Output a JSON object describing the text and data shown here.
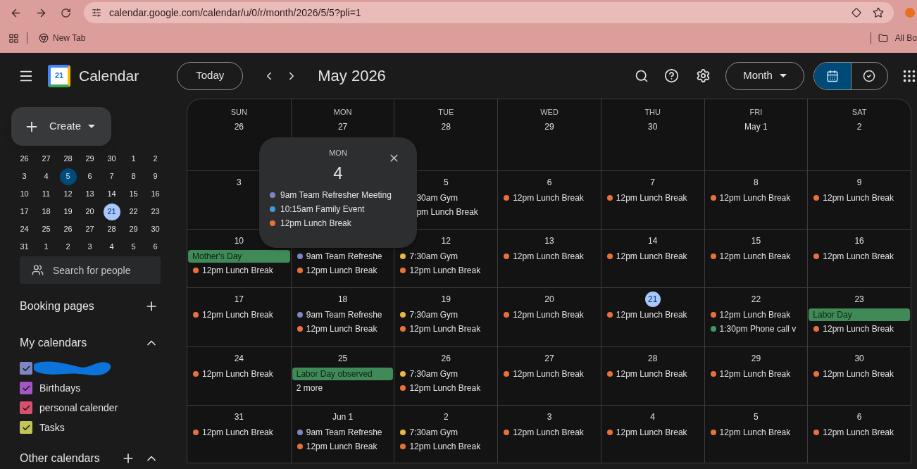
{
  "browser": {
    "url": "calendar.google.com/calendar/u/0/r/month/2026/5/5?pli=1",
    "bookmarks": [
      {
        "label": "New Tab"
      }
    ],
    "all_bookmarks": "All Bo"
  },
  "header": {
    "logo_date": "21",
    "app_name": "Calendar",
    "today_button": "Today",
    "period": "May 2026",
    "view_button": "Month",
    "view_toggle": [
      {
        "kind": "calendar",
        "selected": true
      },
      {
        "kind": "tasks",
        "selected": false
      }
    ]
  },
  "sidebar": {
    "create": "Create",
    "mini_calendar": [
      {
        "d": "26",
        "selected": false,
        "today": false
      },
      {
        "d": "27",
        "selected": false,
        "today": false
      },
      {
        "d": "28",
        "selected": false,
        "today": false
      },
      {
        "d": "29",
        "selected": false,
        "today": false
      },
      {
        "d": "30",
        "selected": false,
        "today": false
      },
      {
        "d": "1",
        "selected": false,
        "today": false
      },
      {
        "d": "2",
        "selected": false,
        "today": false
      },
      {
        "d": "3",
        "selected": false,
        "today": false
      },
      {
        "d": "4",
        "selected": false,
        "today": false
      },
      {
        "d": "5",
        "selected": true,
        "today": false
      },
      {
        "d": "6",
        "selected": false,
        "today": false
      },
      {
        "d": "7",
        "selected": false,
        "today": false
      },
      {
        "d": "8",
        "selected": false,
        "today": false
      },
      {
        "d": "9",
        "selected": false,
        "today": false
      },
      {
        "d": "10",
        "selected": false,
        "today": false
      },
      {
        "d": "11",
        "selected": false,
        "today": false
      },
      {
        "d": "12",
        "selected": false,
        "today": false
      },
      {
        "d": "13",
        "selected": false,
        "today": false
      },
      {
        "d": "14",
        "selected": false,
        "today": false
      },
      {
        "d": "15",
        "selected": false,
        "today": false
      },
      {
        "d": "16",
        "selected": false,
        "today": false
      },
      {
        "d": "17",
        "selected": false,
        "today": false
      },
      {
        "d": "18",
        "selected": false,
        "today": false
      },
      {
        "d": "19",
        "selected": false,
        "today": false
      },
      {
        "d": "20",
        "selected": false,
        "today": false
      },
      {
        "d": "21",
        "selected": false,
        "today": true
      },
      {
        "d": "22",
        "selected": false,
        "today": false
      },
      {
        "d": "23",
        "selected": false,
        "today": false
      },
      {
        "d": "24",
        "selected": false,
        "today": false
      },
      {
        "d": "25",
        "selected": false,
        "today": false
      },
      {
        "d": "26",
        "selected": false,
        "today": false
      },
      {
        "d": "27",
        "selected": false,
        "today": false
      },
      {
        "d": "28",
        "selected": false,
        "today": false
      },
      {
        "d": "29",
        "selected": false,
        "today": false
      },
      {
        "d": "30",
        "selected": false,
        "today": false
      },
      {
        "d": "31",
        "selected": false,
        "today": false
      },
      {
        "d": "1",
        "selected": false,
        "today": false
      },
      {
        "d": "2",
        "selected": false,
        "today": false
      },
      {
        "d": "3",
        "selected": false,
        "today": false
      },
      {
        "d": "4",
        "selected": false,
        "today": false
      },
      {
        "d": "5",
        "selected": false,
        "today": false
      },
      {
        "d": "6",
        "selected": false,
        "today": false
      }
    ],
    "search_people": {
      "placeholder": "Search for people"
    },
    "booking_pages": "Booking pages",
    "my_calendars": {
      "title": "My calendars",
      "expanded": true,
      "items": [
        {
          "kind": "redacted",
          "checked": true,
          "color": "#7f85c4"
        },
        {
          "kind": "named",
          "label": "Birthdays",
          "checked": true,
          "color": "#a356c4"
        },
        {
          "kind": "named",
          "label": "personal calender",
          "checked": true,
          "color": "#d9506f"
        },
        {
          "kind": "named",
          "label": "Tasks",
          "checked": true,
          "color": "#c2c45a"
        }
      ]
    },
    "other_calendars": {
      "title": "Other calendars",
      "expanded": true
    }
  },
  "month_grid": {
    "weekdays": [
      "SUN",
      "MON",
      "TUE",
      "WED",
      "THU",
      "FRI",
      "SAT"
    ],
    "cells": [
      {
        "date": "26"
      },
      {
        "date": "27"
      },
      {
        "date": "28"
      },
      {
        "date": "29"
      },
      {
        "date": "30"
      },
      {
        "date": "May 1"
      },
      {
        "date": "2"
      },
      {
        "date": "3"
      },
      {},
      {
        "date": "5",
        "events": [
          {
            "kind": "partial",
            "text": "30am Gym"
          },
          {
            "kind": "partial",
            "text": "pm Lunch Break"
          }
        ]
      },
      {
        "date": "6",
        "events": [
          {
            "kind": "timed",
            "text": "12pm Lunch Break",
            "color": "#e8703a"
          }
        ]
      },
      {
        "date": "7",
        "events": [
          {
            "kind": "timed",
            "text": "12pm Lunch Break",
            "color": "#e8703a"
          }
        ]
      },
      {
        "date": "8",
        "events": [
          {
            "kind": "timed",
            "text": "12pm Lunch Break",
            "color": "#e8703a"
          }
        ]
      },
      {
        "date": "9",
        "events": [
          {
            "kind": "timed",
            "text": "12pm Lunch Break",
            "color": "#e8703a"
          }
        ]
      },
      {
        "date": "10",
        "events": [
          {
            "kind": "allday",
            "text": "Mother's Day",
            "color": "#3f8a56"
          },
          {
            "kind": "timed",
            "text": "12pm Lunch Break",
            "color": "#e8703a"
          }
        ]
      },
      {
        "events": [
          {
            "kind": "timed",
            "text": "9am Team Refreshe",
            "color": "#7f85c4"
          },
          {
            "kind": "timed",
            "text": "12pm Lunch Break",
            "color": "#e8703a"
          }
        ]
      },
      {
        "date": "12",
        "events": [
          {
            "kind": "timed",
            "text": "7:30am Gym",
            "color": "#e8b73c"
          },
          {
            "kind": "timed",
            "text": "12pm Lunch Break",
            "color": "#e8703a"
          }
        ]
      },
      {
        "date": "13",
        "events": [
          {
            "kind": "timed",
            "text": "12pm Lunch Break",
            "color": "#e8703a"
          }
        ]
      },
      {
        "date": "14",
        "events": [
          {
            "kind": "timed",
            "text": "12pm Lunch Break",
            "color": "#e8703a"
          }
        ]
      },
      {
        "date": "15",
        "events": [
          {
            "kind": "timed",
            "text": "12pm Lunch Break",
            "color": "#e8703a"
          }
        ]
      },
      {
        "date": "16",
        "events": [
          {
            "kind": "timed",
            "text": "12pm Lunch Break",
            "color": "#e8703a"
          }
        ]
      },
      {
        "date": "17",
        "events": [
          {
            "kind": "timed",
            "text": "12pm Lunch Break",
            "color": "#e8703a"
          }
        ]
      },
      {
        "date": "18",
        "events": [
          {
            "kind": "timed",
            "text": "9am Team Refreshe",
            "color": "#7f85c4"
          },
          {
            "kind": "timed",
            "text": "12pm Lunch Break",
            "color": "#e8703a"
          }
        ]
      },
      {
        "date": "19",
        "events": [
          {
            "kind": "timed",
            "text": "7:30am Gym",
            "color": "#e8b73c"
          },
          {
            "kind": "timed",
            "text": "12pm Lunch Break",
            "color": "#e8703a"
          }
        ]
      },
      {
        "date": "20",
        "events": [
          {
            "kind": "timed",
            "text": "12pm Lunch Break",
            "color": "#e8703a"
          }
        ]
      },
      {
        "date": "21",
        "today": true,
        "events": [
          {
            "kind": "timed",
            "text": "12pm Lunch Break",
            "color": "#e8703a"
          }
        ]
      },
      {
        "date": "22",
        "events": [
          {
            "kind": "timed",
            "text": "12pm Lunch Break",
            "color": "#e8703a"
          },
          {
            "kind": "timed",
            "text": "1:30pm Phone call v",
            "color": "#3f9a62"
          }
        ]
      },
      {
        "date": "23",
        "events": [
          {
            "kind": "allday",
            "text": "Labor Day",
            "color": "#3f8a56"
          },
          {
            "kind": "timed",
            "text": "12pm Lunch Break",
            "color": "#e8703a"
          }
        ]
      },
      {
        "date": "24",
        "events": [
          {
            "kind": "timed",
            "text": "12pm Lunch Break",
            "color": "#e8703a"
          }
        ]
      },
      {
        "date": "25",
        "events": [
          {
            "kind": "allday",
            "text": "Labor Day observed",
            "color": "#3f8a56"
          },
          {
            "kind": "more",
            "text": "2 more"
          }
        ]
      },
      {
        "date": "26",
        "events": [
          {
            "kind": "timed",
            "text": "7:30am Gym",
            "color": "#e8b73c"
          },
          {
            "kind": "timed",
            "text": "12pm Lunch Break",
            "color": "#e8703a"
          }
        ]
      },
      {
        "date": "27",
        "events": [
          {
            "kind": "timed",
            "text": "12pm Lunch Break",
            "color": "#e8703a"
          }
        ]
      },
      {
        "date": "28",
        "events": [
          {
            "kind": "timed",
            "text": "12pm Lunch Break",
            "color": "#e8703a"
          }
        ]
      },
      {
        "date": "29",
        "events": [
          {
            "kind": "timed",
            "text": "12pm Lunch Break",
            "color": "#e8703a"
          }
        ]
      },
      {
        "date": "30",
        "events": [
          {
            "kind": "timed",
            "text": "12pm Lunch Break",
            "color": "#e8703a"
          }
        ]
      },
      {
        "date": "31",
        "events": [
          {
            "kind": "timed",
            "text": "12pm Lunch Break",
            "color": "#e8703a"
          }
        ]
      },
      {
        "date": "Jun 1",
        "events": [
          {
            "kind": "timed",
            "text": "9am Team Refreshe",
            "color": "#7f85c4"
          },
          {
            "kind": "timed",
            "text": "12pm Lunch Break",
            "color": "#e8703a"
          }
        ]
      },
      {
        "date": "2",
        "events": [
          {
            "kind": "timed",
            "text": "7:30am Gym",
            "color": "#e8b73c"
          },
          {
            "kind": "timed",
            "text": "12pm Lunch Break",
            "color": "#e8703a"
          }
        ]
      },
      {
        "date": "3",
        "events": [
          {
            "kind": "timed",
            "text": "12pm Lunch Break",
            "color": "#e8703a"
          }
        ]
      },
      {
        "date": "4",
        "events": [
          {
            "kind": "timed",
            "text": "12pm Lunch Break",
            "color": "#e8703a"
          }
        ]
      },
      {
        "date": "5",
        "events": [
          {
            "kind": "timed",
            "text": "12pm Lunch Break",
            "color": "#e8703a"
          }
        ]
      },
      {
        "date": "6",
        "events": [
          {
            "kind": "timed",
            "text": "12pm Lunch Break",
            "color": "#e8703a"
          }
        ]
      }
    ]
  },
  "day_popup": {
    "weekday": "MON",
    "date": "4",
    "events": [
      {
        "text": "9am Team Refresher Meeting",
        "color": "#7f85c4"
      },
      {
        "text": "10:15am Family Event",
        "color": "#3f9be0"
      },
      {
        "text": "12pm Lunch Break",
        "color": "#e8703a"
      }
    ]
  }
}
